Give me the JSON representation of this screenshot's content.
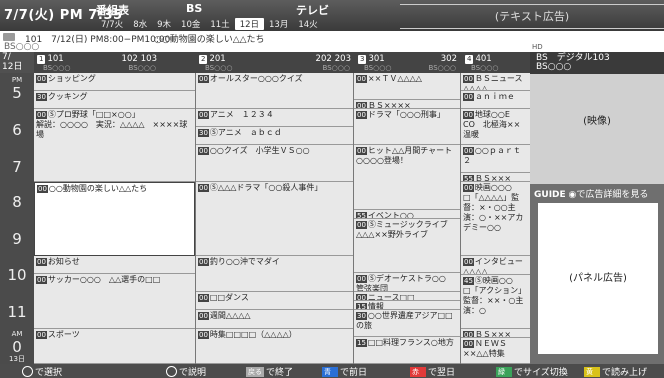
{
  "header": {
    "clock": "7/7(火) PM 7:35",
    "title": "番組表",
    "bs": "BS",
    "tv": "テレビ",
    "dates": [
      "7/7火",
      "8水",
      "9木",
      "10金",
      "11土",
      "12日",
      "13月",
      "14火"
    ],
    "ad": "(テキスト広告)"
  },
  "info": {
    "line1": "101　7/12(日) PM8:00−PM10:00",
    "line2": "○○動物園の楽しい△△たち",
    "line3": "BS○○○",
    "hd": "HD"
  },
  "datecell": {
    "a": "7/",
    "b": "12日"
  },
  "channels": [
    {
      "n": "1",
      "name": "101",
      "n2": "102",
      "n3": "103",
      "s1": "BS○○○",
      "s2": "BS○○○"
    },
    {
      "n": "2",
      "name": "201",
      "n2": "202",
      "n3": "203",
      "s1": "BS○○○",
      "s2": "BS○○○"
    },
    {
      "n": "3",
      "name": "301",
      "n2": "302",
      "n3": "",
      "s1": "BS○○○",
      "s2": "BS○○○"
    },
    {
      "n": "4",
      "name": "401",
      "n2": "",
      "n3": "",
      "s1": "BS○○○",
      "s2": ""
    }
  ],
  "times": [
    {
      "t": "5",
      "p": "PM"
    },
    {
      "t": "6",
      "p": ""
    },
    {
      "t": "7",
      "p": ""
    },
    {
      "t": "8",
      "p": ""
    },
    {
      "t": "9",
      "p": ""
    },
    {
      "t": "10",
      "p": ""
    },
    {
      "t": "11",
      "p": ""
    },
    {
      "t": "0",
      "p": "AM"
    }
  ],
  "endday": "13日",
  "col1": [
    {
      "m": "00",
      "t": "ショッピング"
    },
    {
      "m": "30",
      "t": "クッキング"
    },
    {
      "m": "00",
      "t": "Ⓢプロ野球「□□×○○」",
      "s": "解説：○○○○　実況：△△△△　××××球場"
    },
    {
      "m": "00",
      "t": "○○動物園の楽しい△△たち"
    },
    {
      "m": "00",
      "t": "お知らせ"
    },
    {
      "m": "00",
      "t": "サッカー○○○　△△選手の□□"
    },
    {
      "m": "00",
      "t": "スポーツ"
    }
  ],
  "col2": [
    {
      "m": "00",
      "t": "オールスター○○○クイズ"
    },
    {
      "m": "00",
      "t": "アニメ　１２３４"
    },
    {
      "m": "30",
      "t": "Ⓢアニメ　ａｂｃｄ"
    },
    {
      "m": "00",
      "t": "○○クイズ　小学生ＶＳ○○"
    },
    {
      "m": "00",
      "t": "Ⓢ△△△ドラマ「○○殺人事件」"
    },
    {
      "m": "00",
      "t": "釣り○○沖でマダイ"
    },
    {
      "m": "00",
      "t": "□□ダンス"
    },
    {
      "m": "00",
      "t": "週間△△△△"
    },
    {
      "m": "00",
      "t": "時集□□□□（△△△△）"
    }
  ],
  "col3": [
    {
      "m": "00",
      "t": "××ＴＶ△△△△"
    },
    {
      "m": "00",
      "t": "ＢＳ××××"
    },
    {
      "m": "00",
      "t": "ドラマ「○○○刑事」"
    },
    {
      "m": "00",
      "t": "ヒット△△月間チャート",
      "s": "○○○○登場！"
    },
    {
      "m": "55",
      "t": "イベント○○"
    },
    {
      "m": "00",
      "t": "Ⓢミュージックライブ",
      "s": "△△△××野外ライブ"
    },
    {
      "m": "00",
      "t": "Ⓢデオーケストラ○○",
      "s": "管弦楽団"
    },
    {
      "m": "00",
      "t": "ニュース□□"
    },
    {
      "m": "15",
      "t": "情報"
    },
    {
      "m": "30",
      "t": "○○世界遺産アジア□□の旅"
    },
    {
      "m": "15",
      "t": "□□料理フランス○地方"
    }
  ],
  "col4": [
    {
      "m": "00",
      "t": "ＢＳニュース△△△△"
    },
    {
      "m": "00",
      "t": "ａｎｉｍｅ"
    },
    {
      "m": "00",
      "t": "地球○○E　CO　北極海××温暖"
    },
    {
      "m": "00",
      "t": "○○ｐａｒｔ２"
    },
    {
      "m": "55",
      "t": "ＢＳ×××"
    },
    {
      "m": "00",
      "t": "映画○○○",
      "s": "□「△△△△」監督：×・○○主演：○・××アカデミー○○"
    },
    {
      "m": "00",
      "t": "インタビュー△△△△"
    },
    {
      "m": "45",
      "t": "Ⓢ映画○○",
      "s": "□「アクション」監督：××・○主演：○"
    },
    {
      "m": "00",
      "t": "ＢＳ×××"
    },
    {
      "m": "00",
      "t": "ＮＥＷＳ××△△特集"
    }
  ],
  "right": {
    "title": "BS　デジタル103",
    "sub": "BS○○○",
    "video": "(映像)",
    "guide": "◉で広告詳細を見る",
    "guide_logo": "GUIDE",
    "panel": "(パネル広告)"
  },
  "bottom": {
    "select": "で選択",
    "explain": "で説明",
    "back_key": "戻る",
    "back": "で終了",
    "blue_key": "青",
    "prev": "で前日",
    "red_key": "赤",
    "next": "で翌日",
    "green_key": "緑",
    "size": "でサイズ切換",
    "yellow_key": "黄",
    "read": "で読み上げ"
  }
}
